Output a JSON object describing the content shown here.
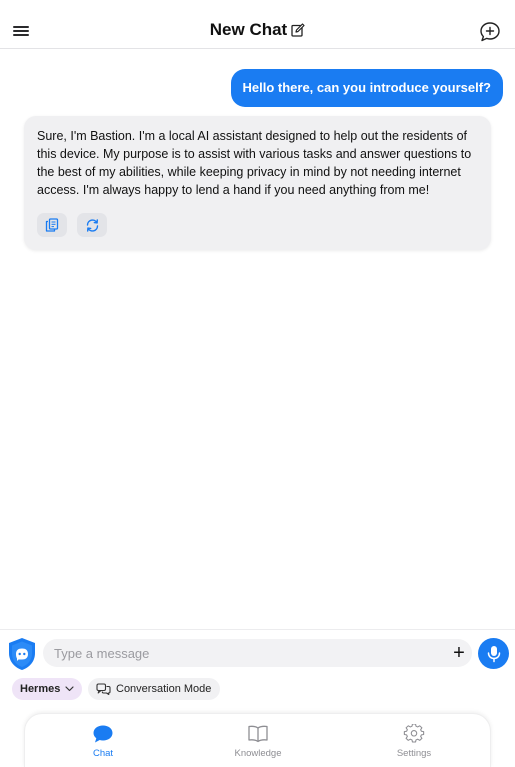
{
  "header": {
    "title": "New Chat",
    "menu_icon": "hamburger-menu-icon",
    "edit_icon": "edit-square-icon",
    "new_chat_icon": "chat-bubble-plus-icon"
  },
  "messages": [
    {
      "role": "user",
      "text": "Hello there, can you introduce yourself?"
    },
    {
      "role": "assistant",
      "text": "Sure, I'm Bastion. I'm a local AI assistant designed to help out the residents of this device. My purpose is to assist with various tasks and answer questions to the best of my abilities, while keeping privacy in mind by not needing internet access. I'm always happy to lend a hand if you need anything from me!"
    }
  ],
  "message_actions": {
    "copy_icon": "copy-icon",
    "regenerate_icon": "refresh-icon"
  },
  "composer": {
    "placeholder": "Type a message",
    "value": "",
    "add_label": "+",
    "model": "Hermes",
    "mode_label": "Conversation Mode"
  },
  "tabs": [
    {
      "label": "Chat",
      "icon": "chat-bubble-icon",
      "active": true
    },
    {
      "label": "Knowledge",
      "icon": "book-icon",
      "active": false
    },
    {
      "label": "Settings",
      "icon": "gear-icon",
      "active": false
    }
  ],
  "colors": {
    "accent": "#1a7cf2",
    "assistant_bubble": "#f0f0f2",
    "model_pill": "#efe4f7"
  }
}
